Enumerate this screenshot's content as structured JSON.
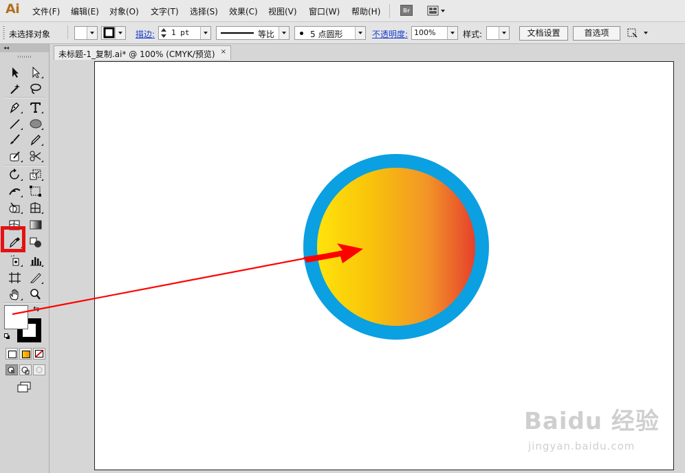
{
  "app": {
    "logo": "Ai"
  },
  "menu": {
    "items": [
      "文件(F)",
      "编辑(E)",
      "对象(O)",
      "文字(T)",
      "选择(S)",
      "效果(C)",
      "视图(V)",
      "窗口(W)",
      "帮助(H)"
    ],
    "bridge_label": "Br"
  },
  "control_bar": {
    "selection_status": "未选择对象",
    "stroke_label": "描边:",
    "stroke_weight": "1 pt",
    "stroke_profile": "等比",
    "brush": "5 点圆形",
    "opacity_label": "不透明度:",
    "opacity_value": "100%",
    "style_label": "样式:",
    "doc_setup_button": "文档设置",
    "preferences_button": "首选项"
  },
  "document": {
    "tab_title": "未标题-1_复制.ai* @ 100% (CMYK/预览)",
    "close_glyph": "×"
  },
  "toolbar": {
    "collapse_glyph": "◂◂",
    "swap_glyph": "⇆"
  },
  "artwork": {
    "ring_color": "#0aa0e2",
    "gradient_colors": [
      "#ffe30b",
      "#f29428",
      "#e6402b"
    ],
    "arrow_color": "#ff0000",
    "highlight_color": "#e41212"
  },
  "watermark": {
    "brand": "Baidu 经验",
    "url": "jingyan.baidu.com"
  }
}
